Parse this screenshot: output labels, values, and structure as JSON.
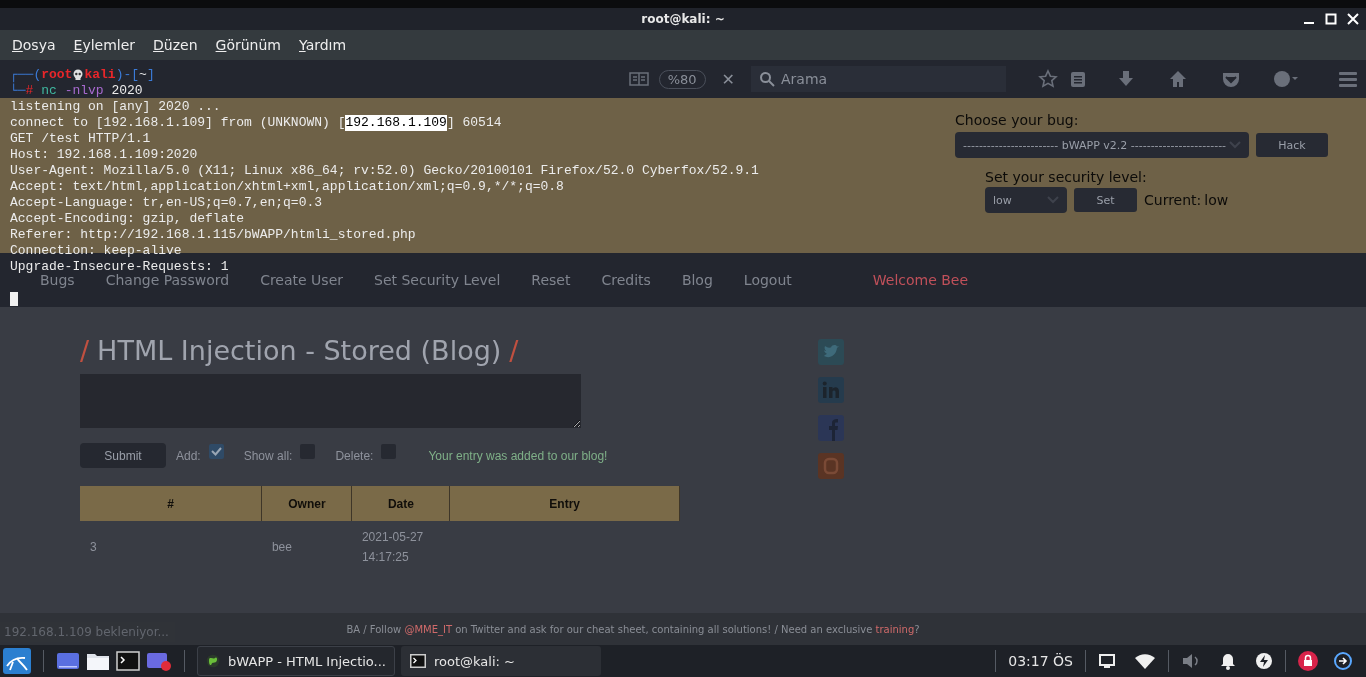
{
  "terminal": {
    "title": "root@kali: ~",
    "menu": [
      "Dosya",
      "Eylemler",
      "Düzen",
      "Görünüm",
      "Yardım"
    ],
    "prompt_top": [
      {
        "kind": "frame",
        "text": "┌──("
      },
      {
        "kind": "user",
        "text": "root"
      },
      {
        "kind": "skull"
      },
      {
        "kind": "user",
        "text": "kali"
      },
      {
        "kind": "frame",
        "text": ")-["
      },
      {
        "kind": "dir",
        "text": "~"
      },
      {
        "kind": "frame",
        "text": "]"
      }
    ],
    "prompt_bottom": [
      {
        "kind": "frame",
        "text": "└─"
      },
      {
        "kind": "hash",
        "text": "#"
      },
      {
        "kind": "command",
        "text": " nc"
      },
      {
        "kind": "option",
        "text": " -nlvp"
      },
      {
        "kind": "plain",
        "text": " 2020"
      }
    ],
    "lines": [
      {
        "parts": [
          {
            "text": "listening on [any] 2020 ...",
            "selected": false
          }
        ]
      },
      {
        "parts": [
          {
            "text": "connect to [192.168.1.109] from (UNKNOWN) [",
            "selected": false
          },
          {
            "text": "192.168.1.109",
            "selected": true
          },
          {
            "text": "] 60514",
            "selected": false
          }
        ]
      },
      {
        "parts": [
          {
            "text": "GET /test HTTP/1.1",
            "selected": false
          }
        ]
      },
      {
        "parts": [
          {
            "text": "Host: 192.168.1.109:2020",
            "selected": false
          }
        ]
      },
      {
        "parts": [
          {
            "text": "User-Agent: Mozilla/5.0 (X11; Linux x86_64; rv:52.0) Gecko/20100101 Firefox/52.0 Cyberfox/52.9.1",
            "selected": false
          }
        ]
      },
      {
        "parts": [
          {
            "text": "Accept: text/html,application/xhtml+xml,application/xml;q=0.9,*/*;q=0.8",
            "selected": false
          }
        ]
      },
      {
        "parts": [
          {
            "text": "Accept-Language: tr,en-US;q=0.7,en;q=0.3",
            "selected": false
          }
        ]
      },
      {
        "parts": [
          {
            "text": "Accept-Encoding: gzip, deflate",
            "selected": false
          }
        ]
      },
      {
        "parts": [
          {
            "text": "Referer: http://192.168.1.115/bWAPP/htmli_stored.php",
            "selected": false
          }
        ]
      },
      {
        "parts": [
          {
            "text": "Connection: keep-alive",
            "selected": false
          }
        ]
      },
      {
        "parts": [
          {
            "text": "Upgrade-Insecure-Requests: 1",
            "selected": false
          }
        ]
      }
    ]
  },
  "browser": {
    "zoom": "%80",
    "stop_button": "✕",
    "search": {
      "placeholder": "Arama"
    },
    "header": {
      "bug_label": "Choose your bug:",
      "bug_select": "------------------------ bWAPP v2.2 ------------------------",
      "hack_button": "Hack",
      "security_label": "Set your security level:",
      "security_select": "low",
      "set_button": "Set",
      "current_label": "Current:",
      "current_value": "low"
    },
    "nav": [
      {
        "label": "Bugs",
        "kind": "link"
      },
      {
        "label": "Change Password",
        "kind": "link"
      },
      {
        "label": "Create User",
        "kind": "link"
      },
      {
        "label": "Set Security Level",
        "kind": "link"
      },
      {
        "label": "Reset",
        "kind": "link"
      },
      {
        "label": "Credits",
        "kind": "link"
      },
      {
        "label": "Blog",
        "kind": "link"
      },
      {
        "label": "Logout",
        "kind": "link"
      },
      {
        "label": "Welcome Bee",
        "kind": "welcome"
      }
    ],
    "page": {
      "title_mark_left": "/",
      "title": "HTML Injection - Stored (Blog)",
      "title_mark_right": "/"
    },
    "form": {
      "submit": "Submit",
      "options": [
        {
          "label": "Add:",
          "checked": true
        },
        {
          "label": "Show all:",
          "checked": false
        },
        {
          "label": "Delete:",
          "checked": false
        }
      ],
      "message": "Your entry was added to our blog!"
    },
    "table": {
      "columns": [
        "#",
        "Owner",
        "Date",
        "Entry"
      ],
      "rows": [
        {
          "number": "3",
          "owner": "bee",
          "date": "2021-05-27 14:17:25"
        }
      ]
    },
    "footer": [
      {
        "kind": "text",
        "text": "BA / Follow "
      },
      {
        "kind": "link",
        "text": "@MME_IT"
      },
      {
        "kind": "text",
        "text": " on Twitter and ask for our cheat sheet, containing all solutions! / Need an exclusive "
      },
      {
        "kind": "link",
        "text": "training"
      },
      {
        "kind": "text",
        "text": "?"
      }
    ],
    "status": "192.168.1.109 bekleniyor..."
  },
  "taskbar": {
    "tasks": [
      {
        "label": "bWAPP - HTML Injectio...",
        "kind": "browser",
        "selected": false
      },
      {
        "label": "root@kali: ~",
        "kind": "terminal",
        "selected": true
      }
    ],
    "clock": "03:17 ÖS"
  }
}
